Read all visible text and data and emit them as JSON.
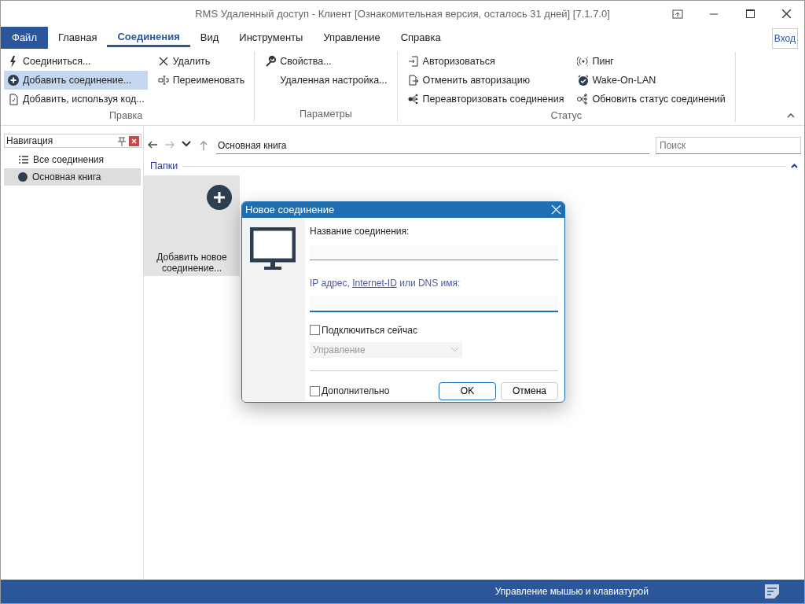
{
  "window": {
    "title": "RMS Удаленный доступ - Клиент [Ознакомительная версия, осталось 31 дней] [7.1.7.0]"
  },
  "menu_tabs": [
    {
      "label": "Файл",
      "kind": "file",
      "selected": false
    },
    {
      "label": "Главная",
      "kind": "tab",
      "selected": false
    },
    {
      "label": "Соединения",
      "kind": "tab",
      "selected": true
    },
    {
      "label": "Вид",
      "kind": "tab",
      "selected": false
    },
    {
      "label": "Инструменты",
      "kind": "tab",
      "selected": false
    },
    {
      "label": "Управление",
      "kind": "tab",
      "selected": false
    },
    {
      "label": "Справка",
      "kind": "tab",
      "selected": false
    }
  ],
  "login_button": "Вход",
  "ribbon": [
    {
      "name": "Правка",
      "columns": [
        [
          {
            "label": "Соединиться...",
            "selected": false
          },
          {
            "label": "Добавить соединение...",
            "selected": true
          },
          {
            "label": "Добавить, используя код...",
            "selected": false
          }
        ],
        [
          {
            "label": "Удалить",
            "selected": false
          },
          {
            "label": "Переименовать",
            "selected": false
          }
        ]
      ]
    },
    {
      "name": "Параметры",
      "columns": [
        [
          {
            "label": "Свойства...",
            "selected": false
          },
          {
            "label": "Удаленная настройка...",
            "selected": false
          }
        ]
      ]
    },
    {
      "name": "Статус",
      "columns": [
        [
          {
            "label": "Авторизоваться",
            "selected": false
          },
          {
            "label": "Отменить авторизацию",
            "selected": false
          },
          {
            "label": "Переавторизовать соединения",
            "selected": false
          }
        ],
        [
          {
            "label": "Пинг",
            "selected": false
          },
          {
            "label": "Wake-On-LAN",
            "selected": false
          },
          {
            "label": "Обновить статус соединений",
            "selected": false
          }
        ]
      ]
    }
  ],
  "navigation": {
    "title": "Навигация",
    "items": [
      {
        "label": "Все соединения",
        "kind": "list",
        "selected": false
      },
      {
        "label": "Основная книга",
        "kind": "book",
        "selected": true
      }
    ]
  },
  "address_bar": {
    "path": "Основная книга",
    "search_placeholder": "Поиск"
  },
  "folders": {
    "title": "Папки",
    "tile": "Добавить новое соединение..."
  },
  "dialog": {
    "title": "Новое соединение",
    "name_label": "Название соединения:",
    "address_label": {
      "before": "IP адрес, ",
      "link": "Internet-ID",
      "after": " или DNS имя:"
    },
    "address_focused": true,
    "connect_now": {
      "label": "Подключиться сейчас",
      "checked": false
    },
    "mode": {
      "value": "Управление",
      "disabled": true
    },
    "advanced": {
      "label": "Дополнительно",
      "checked": false
    },
    "buttons": [
      {
        "label": "OK",
        "kind": "primary"
      },
      {
        "label": "Отмена",
        "kind": "secondary"
      }
    ]
  },
  "status_bar": {
    "text": "Управление мышью и клавиатурой"
  }
}
